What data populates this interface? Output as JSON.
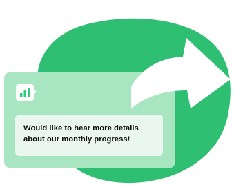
{
  "message": {
    "line1": "Would like to hear more details",
    "line2": "about our monthly progress!"
  },
  "icons": {
    "chat": "chat-bar-chart-icon",
    "share": "share-forward-arrow-icon"
  },
  "colors": {
    "blob": "#2fbf72",
    "card": "#a8e6c2",
    "message_bg": "#eaf7ef",
    "icon_bg": "#ffffff",
    "icon_bars": "#33c97f",
    "arrow": "#ffffff",
    "text": "#0f0f0f"
  }
}
